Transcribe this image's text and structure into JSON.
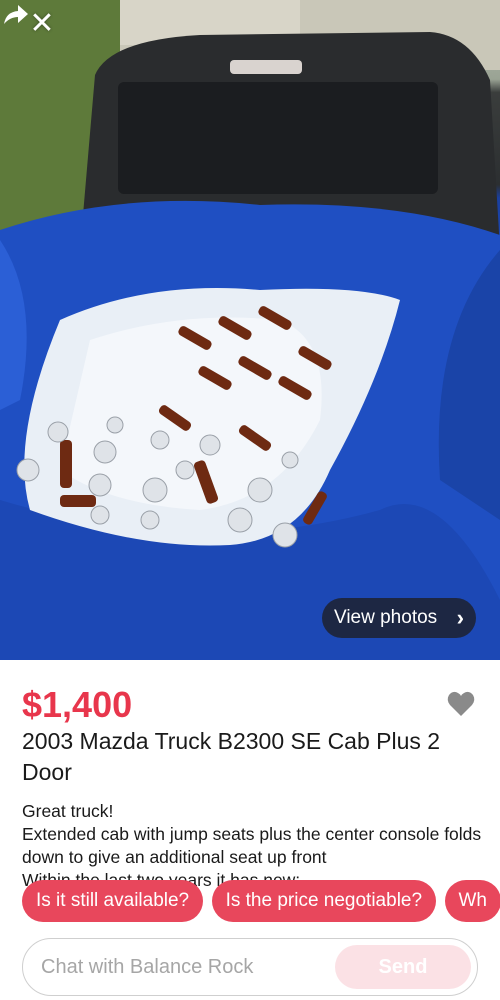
{
  "photo": {
    "view_photos_label": "View photos",
    "close_icon": "close-icon",
    "share_icon": "share-icon"
  },
  "listing": {
    "price": "$1,400",
    "title": "2003 Mazda Truck B2300 SE Cab Plus 2 Door",
    "description_line1": "Great truck!",
    "description_line2": "Extended cab with jump seats plus the center console folds down to give an additional seat up front",
    "description_line3": "Within the last two years it has new:",
    "favorite_icon": "heart-icon",
    "accent_color": "#e8364c"
  },
  "quick_replies": [
    "Is it still available?",
    "Is the price negotiable?",
    "Wh"
  ],
  "chat": {
    "placeholder": "Chat with Balance Rock",
    "send_label": "Send"
  }
}
